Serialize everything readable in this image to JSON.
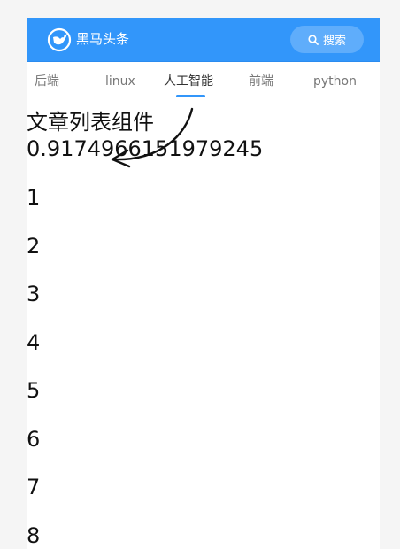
{
  "navbar": {
    "logo_text": "黑马头条",
    "search_label": "搜索",
    "color": "#3296fa"
  },
  "tabs": [
    {
      "label": "后端",
      "active": false
    },
    {
      "label": "linux",
      "active": false
    },
    {
      "label": "人工智能",
      "active": true
    },
    {
      "label": "前端",
      "active": false
    },
    {
      "label": "python",
      "active": false
    }
  ],
  "content": {
    "title": "文章列表组件",
    "random_value": "0.9174966151979245",
    "items": [
      "1",
      "2",
      "3",
      "4",
      "5",
      "6",
      "7",
      "8"
    ]
  },
  "icons": {
    "logo": "toutiao-logo-icon",
    "search": "search-icon",
    "annotation": "curved-arrow-icon"
  }
}
